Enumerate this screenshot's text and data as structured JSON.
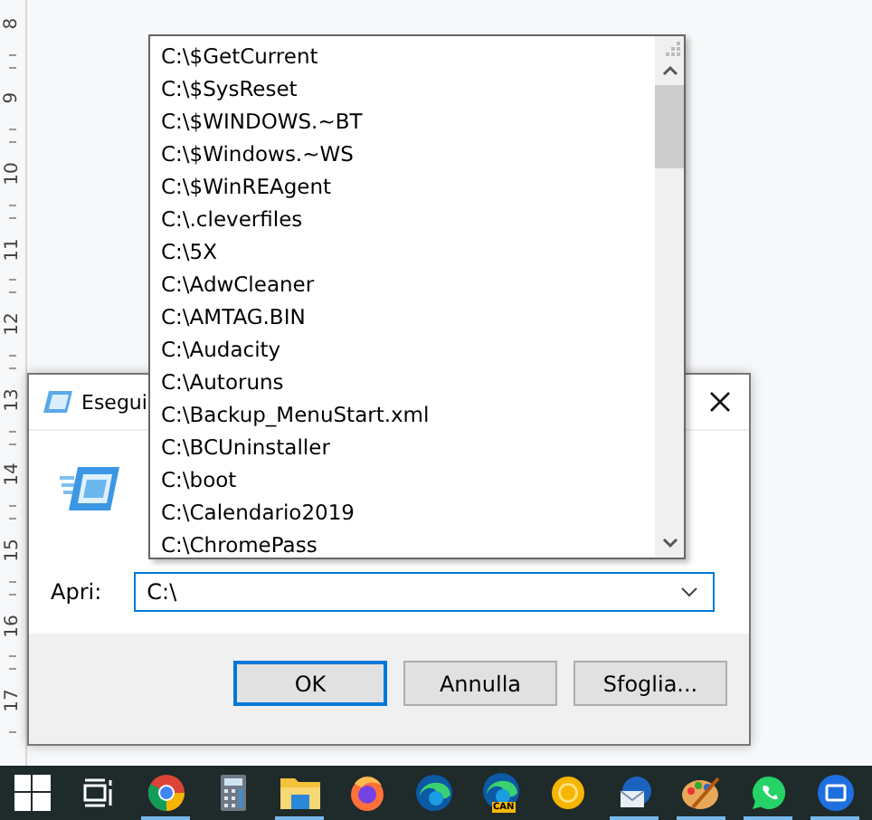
{
  "ruler": {
    "labels": [
      "8",
      "9",
      "10",
      "11",
      "12",
      "13",
      "14",
      "15",
      "16",
      "17"
    ]
  },
  "dialog": {
    "title": "Esegui",
    "open_label": "Apri:",
    "open_value": "C:\\",
    "buttons": [
      {
        "label": "OK",
        "default": true
      },
      {
        "label": "Annulla",
        "default": false
      },
      {
        "label": "Sfoglia...",
        "default": false
      }
    ]
  },
  "dropdown": {
    "items": [
      "C:\\$GetCurrent",
      "C:\\$SysReset",
      "C:\\$WINDOWS.~BT",
      "C:\\$Windows.~WS",
      "C:\\$WinREAgent",
      "C:\\.cleverfiles",
      "C:\\5X",
      "C:\\AdwCleaner",
      "C:\\AMTAG.BIN",
      "C:\\Audacity",
      "C:\\Autoruns",
      "C:\\Backup_MenuStart.xml",
      "C:\\BCUninstaller",
      "C:\\boot",
      "C:\\Calendario2019",
      "C:\\ChromePass"
    ]
  },
  "taskbar": {
    "apps": [
      {
        "kind": "start",
        "running": false
      },
      {
        "kind": "taskview",
        "running": false
      },
      {
        "kind": "chrome",
        "running": true
      },
      {
        "kind": "calculator",
        "running": false
      },
      {
        "kind": "folder",
        "running": true
      },
      {
        "kind": "firefox",
        "running": false
      },
      {
        "kind": "edge",
        "running": false
      },
      {
        "kind": "edge-badge",
        "running": false,
        "badge": "CAN"
      },
      {
        "kind": "ring",
        "running": false
      },
      {
        "kind": "mail",
        "running": true
      },
      {
        "kind": "paint",
        "running": true
      },
      {
        "kind": "whatsapp",
        "running": true
      },
      {
        "kind": "window",
        "running": true
      }
    ]
  }
}
